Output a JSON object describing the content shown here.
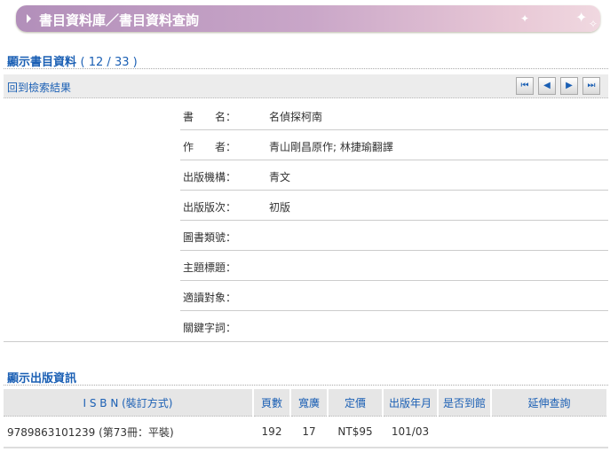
{
  "banner": {
    "title": "書目資料庫／書目資料查詢"
  },
  "section1": {
    "title": "顯示書目資料",
    "count": "( 12 / 33 )"
  },
  "toolbar": {
    "back_link": "回到檢索結果",
    "nav": {
      "first": "⏮",
      "prev": "◀",
      "next": "▶",
      "last": "⏭"
    }
  },
  "details": [
    {
      "label": "書　　名：",
      "value": "名偵探柯南"
    },
    {
      "label": "作　　者：",
      "value": "青山剛昌原作; 林捷瑜翻譯"
    },
    {
      "label": "出版機構：",
      "value": "青文"
    },
    {
      "label": "出版版次：",
      "value": "初版"
    },
    {
      "label": "圖書類號：",
      "value": ""
    },
    {
      "label": "主題標題：",
      "value": ""
    },
    {
      "label": "適讀對象：",
      "value": ""
    },
    {
      "label": "關鍵字詞：",
      "value": ""
    }
  ],
  "section2": {
    "title": "顯示出版資訊"
  },
  "pub_table": {
    "headers": [
      "I S B N (裝訂方式)",
      "頁數",
      "寬廣",
      "定價",
      "出版年月",
      "是否到館",
      "延伸查詢"
    ],
    "rows": [
      [
        "9789863101239 (第73冊：平裝)",
        "192",
        "17",
        "NT$95",
        "101/03",
        "",
        ""
      ]
    ]
  }
}
